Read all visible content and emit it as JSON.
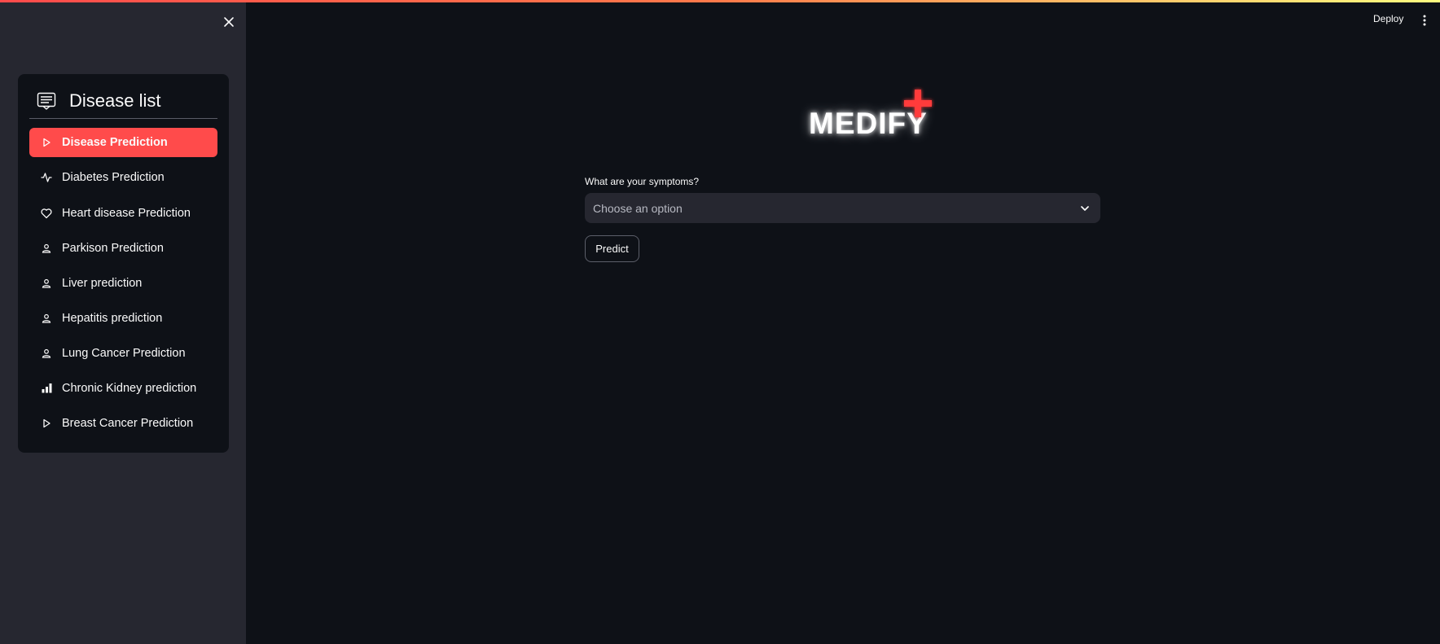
{
  "sidebar": {
    "close_icon": "close-icon",
    "menu": {
      "title": "Disease list",
      "title_icon": "list-icon",
      "active_color": "#ff4b4b",
      "items": [
        {
          "label": "Disease Prediction",
          "icon": "play-icon",
          "active": true
        },
        {
          "label": "Diabetes Prediction",
          "icon": "activity-icon",
          "active": false
        },
        {
          "label": "Heart disease Prediction",
          "icon": "heart-icon",
          "active": false
        },
        {
          "label": "Parkison Prediction",
          "icon": "person-icon",
          "active": false
        },
        {
          "label": "Liver prediction",
          "icon": "person-icon",
          "active": false
        },
        {
          "label": "Hepatitis prediction",
          "icon": "person-icon",
          "active": false
        },
        {
          "label": "Lung Cancer Prediction",
          "icon": "person-icon",
          "active": false
        },
        {
          "label": "Chronic Kidney prediction",
          "icon": "bar-chart-icon",
          "active": false
        },
        {
          "label": "Breast Cancer Prediction",
          "icon": "play-icon",
          "active": false
        }
      ]
    }
  },
  "header": {
    "deploy_label": "Deploy",
    "menu_icon": "kebab-menu-icon"
  },
  "main": {
    "logo_text": "MEDIFY",
    "logo_cross_color": "#ff3b3b",
    "symptoms_label": "What are your symptoms?",
    "symptoms_placeholder": "Choose an option",
    "predict_label": "Predict"
  },
  "colors": {
    "background": "#0e1117",
    "sidebar": "#262730",
    "accent": "#ff4b4b"
  }
}
